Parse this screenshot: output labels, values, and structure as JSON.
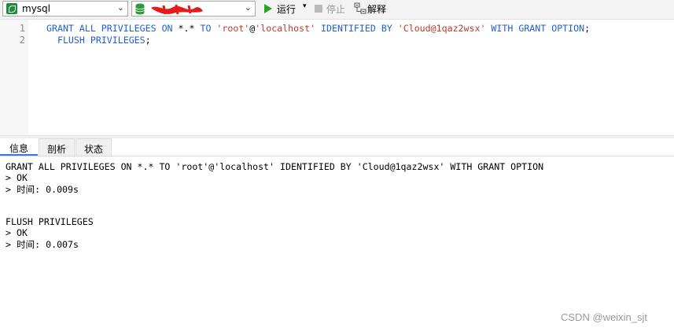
{
  "toolbar": {
    "connection": "mysql",
    "database": "",
    "run_label": "运行",
    "stop_label": "停止",
    "explain_label": "解释",
    "colors": {
      "run": "#2aa32a",
      "mysql_icon": "#1f8a3b",
      "db_icon": "#2e9b3a",
      "redaction": "#e81919"
    }
  },
  "editor": {
    "line_numbers": [
      "1",
      "2"
    ],
    "lines": [
      [
        {
          "t": "GRANT ALL PRIVILEGES ON ",
          "c": "kw"
        },
        {
          "t": "*.*",
          "c": ""
        },
        {
          "t": " TO ",
          "c": "kw"
        },
        {
          "t": "'root'",
          "c": "str"
        },
        {
          "t": "@",
          "c": ""
        },
        {
          "t": "'localhost'",
          "c": "str"
        },
        {
          "t": " IDENTIFIED BY ",
          "c": "kw"
        },
        {
          "t": "'Cloud@1qaz2wsx'",
          "c": "str"
        },
        {
          "t": " WITH GRANT OPTION",
          "c": "kw"
        },
        {
          "t": ";",
          "c": ""
        }
      ],
      [
        {
          "t": "  FLUSH PRIVILEGES",
          "c": "kw"
        },
        {
          "t": ";",
          "c": ""
        }
      ]
    ]
  },
  "tabs": [
    {
      "label": "信息"
    },
    {
      "label": "剖析"
    },
    {
      "label": "状态"
    }
  ],
  "output": {
    "lines": [
      "GRANT ALL PRIVILEGES ON *.* TO 'root'@'localhost' IDENTIFIED BY 'Cloud@1qaz2wsx' WITH GRANT OPTION",
      "> OK",
      "> 时间: 0.009s",
      "",
      "",
      "FLUSH PRIVILEGES",
      "> OK",
      "> 时间: 0.007s"
    ]
  },
  "watermark": "CSDN @weixin_sjt"
}
